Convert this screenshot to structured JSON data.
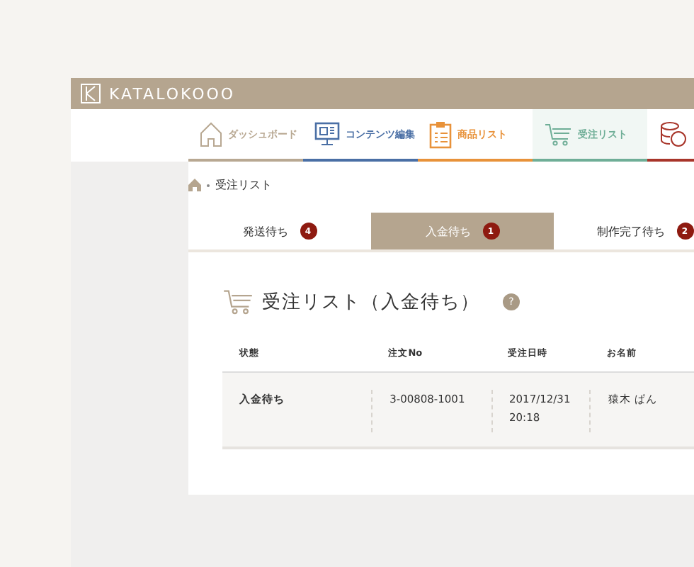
{
  "app": {
    "logo": "KATALOKOOO"
  },
  "nav": [
    {
      "label": "ダッシュボード",
      "color": "#b8a892",
      "selected": false
    },
    {
      "label": "コンテンツ編集",
      "color": "#4a6fa5",
      "selected": false
    },
    {
      "label": "商品リスト",
      "color": "#e8923a",
      "selected": false
    },
    {
      "label": "受注リスト",
      "color": "#6fae97",
      "selected": true
    },
    {
      "color": "#a8352a",
      "selected": false
    }
  ],
  "breadcrumb": {
    "current": "受注リスト"
  },
  "tabs": [
    {
      "label": "発送待ち",
      "count": "4",
      "selected": false
    },
    {
      "label": "入金待ち",
      "count": "1",
      "selected": true
    },
    {
      "label": "制作完了待ち",
      "count": "2",
      "selected": false
    }
  ],
  "title": "受注リスト（入金待ち）",
  "help": "?",
  "table": {
    "columns": [
      "状態",
      "注文No",
      "受注日時",
      "お名前"
    ],
    "rows": [
      [
        "入金待ち",
        "3-00808-1001",
        "2017/12/31\n20:18",
        "猿木 ぱん"
      ]
    ]
  }
}
